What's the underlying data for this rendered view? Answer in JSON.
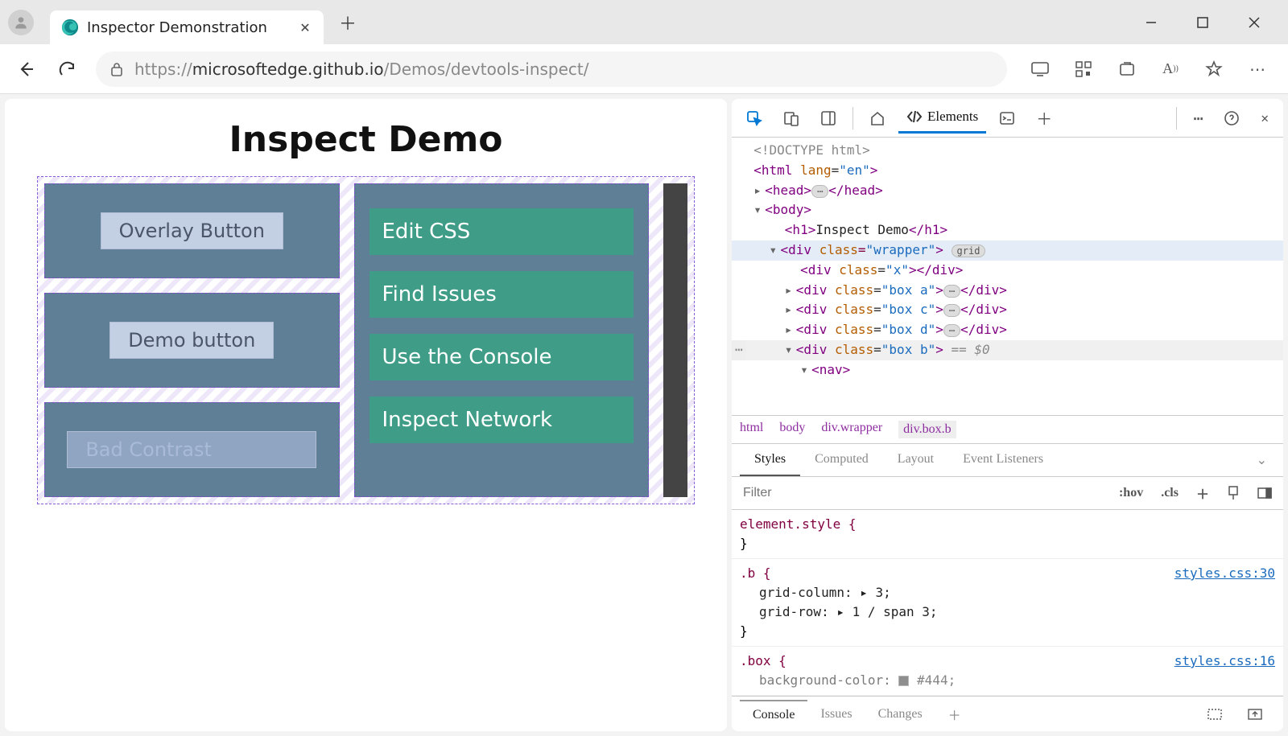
{
  "browser": {
    "tab_title": "Inspector Demonstration",
    "url_full": "https://microsoftedge.github.io/Demos/devtools-inspect/",
    "url_host": "microsoftedge.github.io",
    "url_prefix": "https://",
    "url_path": "/Demos/devtools-inspect/"
  },
  "page": {
    "heading": "Inspect Demo",
    "left_buttons": [
      "Overlay Button",
      "Demo button",
      "Bad Contrast"
    ],
    "right_links": [
      "Edit CSS",
      "Find Issues",
      "Use the Console",
      "Inspect Network"
    ]
  },
  "devtools": {
    "tabs": {
      "elements": "Elements"
    },
    "dom": {
      "doctype": "<!DOCTYPE html>",
      "html_open": "html",
      "html_lang": "en",
      "head": "head",
      "body": "body",
      "h1_text": "Inspect Demo",
      "wrapper_class": "wrapper",
      "grid_badge": "grid",
      "x_class": "x",
      "box_a": "box a",
      "box_c": "box c",
      "box_d": "box d",
      "box_b": "box b",
      "selected_hint": "== $0",
      "nav": "nav"
    },
    "breadcrumb": [
      "html",
      "body",
      "div.wrapper",
      "div.box.b"
    ],
    "styles_tabs": [
      "Styles",
      "Computed",
      "Layout",
      "Event Listeners"
    ],
    "filter_placeholder": "Filter",
    "filter_controls": {
      "hov": ":hov",
      "cls": ".cls"
    },
    "rules": {
      "element_style": "element.style {",
      "close_brace": "}",
      "b_selector": ".b {",
      "b_src": "styles.css:30",
      "b_props": [
        "grid-column: ▸ 3;",
        "grid-row: ▸ 1 / span 3;"
      ],
      "box_selector": ".box {",
      "box_src": "styles.css:16",
      "box_prop_label": "background-color:",
      "box_prop_val": "#444;"
    },
    "drawer_tabs": [
      "Console",
      "Issues",
      "Changes"
    ]
  }
}
